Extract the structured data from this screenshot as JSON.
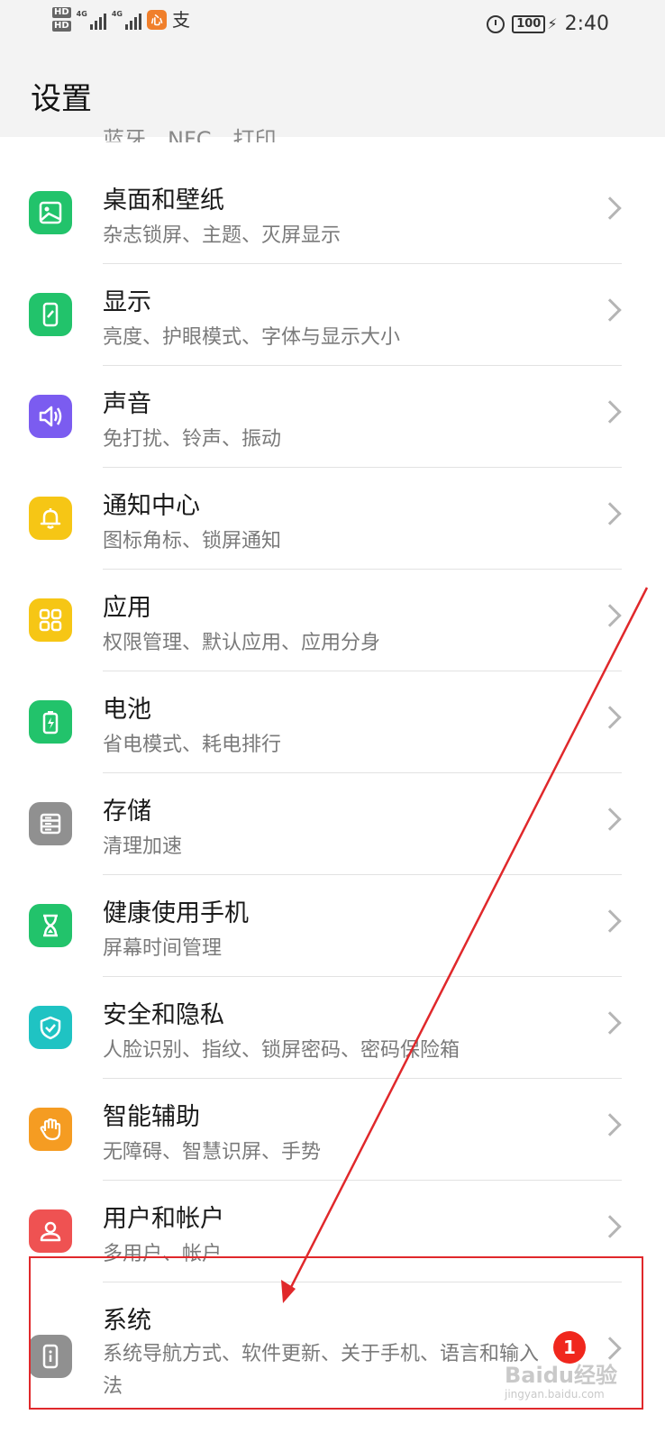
{
  "status_bar": {
    "hd1": "HD",
    "hd2": "HD",
    "net1": "4G",
    "net2": "4G",
    "app1_glyph": "心",
    "app2_glyph": "支",
    "battery": "100",
    "time": "2:40"
  },
  "header": {
    "title": "设置"
  },
  "peek_subtitle": "蓝牙、NFC、打印",
  "items": [
    {
      "title": "桌面和壁纸",
      "subtitle": "杂志锁屏、主题、灭屏显示",
      "icon": "wallpaper-icon",
      "color": "#22c36b"
    },
    {
      "title": "显示",
      "subtitle": "亮度、护眼模式、字体与显示大小",
      "icon": "display-icon",
      "color": "#22c36b"
    },
    {
      "title": "声音",
      "subtitle": "免打扰、铃声、振动",
      "icon": "speaker-icon",
      "color": "#7b5cf0"
    },
    {
      "title": "通知中心",
      "subtitle": "图标角标、锁屏通知",
      "icon": "bell-icon",
      "color": "#f6c615"
    },
    {
      "title": "应用",
      "subtitle": "权限管理、默认应用、应用分身",
      "icon": "apps-grid-icon",
      "color": "#f6c615"
    },
    {
      "title": "电池",
      "subtitle": "省电模式、耗电排行",
      "icon": "battery-icon",
      "color": "#22c36b"
    },
    {
      "title": "存储",
      "subtitle": "清理加速",
      "icon": "storage-icon",
      "color": "#909090"
    },
    {
      "title": "健康使用手机",
      "subtitle": "屏幕时间管理",
      "icon": "hourglass-icon",
      "color": "#22c36b"
    },
    {
      "title": "安全和隐私",
      "subtitle": "人脸识别、指纹、锁屏密码、密码保险箱",
      "icon": "shield-icon",
      "color": "#1fc3c3"
    },
    {
      "title": "智能辅助",
      "subtitle": "无障碍、智慧识屏、手势",
      "icon": "hand-icon",
      "color": "#f59c22"
    },
    {
      "title": "用户和帐户",
      "subtitle": "多用户、帐户",
      "icon": "user-icon",
      "color": "#ef5252"
    },
    {
      "title": "系统",
      "subtitle": "系统导航方式、软件更新、关于手机、语言和输入法",
      "icon": "info-phone-icon",
      "color": "#909090",
      "badge": "1"
    }
  ],
  "watermark": {
    "text": "Baidu经验",
    "url": "jingyan.baidu.com"
  },
  "colors": {
    "highlight": "#e0282b",
    "badge": "#f0271d",
    "header_bg": "#f3f3f3"
  }
}
